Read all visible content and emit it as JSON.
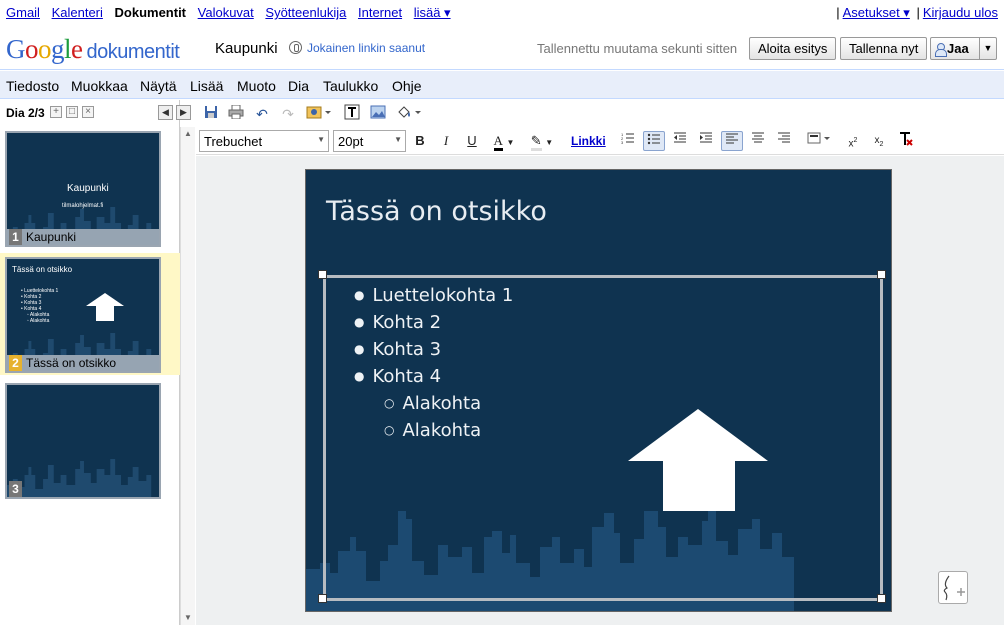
{
  "gbar": {
    "links": [
      "Gmail",
      "Kalenteri",
      "Dokumentit",
      "Valokuvat",
      "Syötteenlukija",
      "Internet",
      "lisää ▾"
    ],
    "settings": "Asetukset ▾",
    "signout": "Kirjaudu ulos"
  },
  "header": {
    "logo_google": "Google",
    "logo_docs": "dokumentit",
    "doc_title": "Kaupunki",
    "share_note": "Jokainen linkin saanut",
    "saved_status": "Tallennettu muutama sekunti sitten",
    "present_label": "Aloita esitys",
    "save_label": "Tallenna nyt",
    "share_label": "Jaa"
  },
  "menu": [
    "Tiedosto",
    "Muokkaa",
    "Näytä",
    "Lisää",
    "Muoto",
    "Dia",
    "Taulukko",
    "Ohje"
  ],
  "sidebar": {
    "counter": "Dia 2/3",
    "slides": [
      {
        "num": "1",
        "caption": "Kaupunki",
        "thumb_title": "Kaupunki",
        "thumb_sub": "tilmalohjelmat.fi"
      },
      {
        "num": "2",
        "caption": "Tässä on otsikko",
        "thumb_title": "Tässä on otsikko",
        "thumb_items": [
          "Luettelokohta 1",
          "Kohta 2",
          "Kohta 3",
          "Kohta 4",
          "Alakohta",
          "Alakohta"
        ]
      },
      {
        "num": "3",
        "caption": ""
      }
    ]
  },
  "format": {
    "font": "Trebuchet",
    "size": "20pt",
    "link_label": "Linkki"
  },
  "slide": {
    "title": "Tässä on otsikko",
    "bullets": [
      "Luettelokohta 1",
      "Kohta 2",
      "Kohta 3",
      "Kohta 4"
    ],
    "sub_bullets": [
      "Alakohta",
      "Alakohta"
    ],
    "bg_color": "#0f3350"
  }
}
